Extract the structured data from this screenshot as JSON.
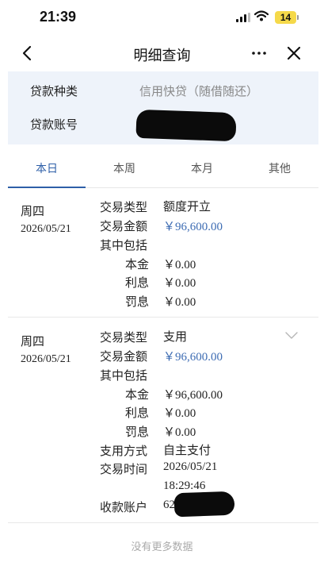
{
  "status_bar": {
    "time": "21:39",
    "battery": "14"
  },
  "nav": {
    "title": "明细查询",
    "back_icon": "chevron-left-icon",
    "more_icon": "ellipsis-icon",
    "close_icon": "close-icon"
  },
  "loan_info": {
    "type_label": "贷款种类",
    "type_value": "信用快贷（随借随还）",
    "account_label": "贷款账号",
    "account_value": ""
  },
  "tabs": [
    {
      "label": "本日",
      "active": true
    },
    {
      "label": "本周",
      "active": false
    },
    {
      "label": "本月",
      "active": false
    },
    {
      "label": "其他",
      "active": false
    }
  ],
  "records": [
    {
      "weekday": "周四",
      "date": "2026/05/21",
      "type_label": "交易类型",
      "type_value": "额度开立",
      "amount_label": "交易金额",
      "amount_value": "￥96,600.00",
      "includes_label": "其中包括",
      "principal_label": "本金",
      "principal_value": "￥0.00",
      "interest_label": "利息",
      "interest_value": "￥0.00",
      "penalty_label": "罚息",
      "penalty_value": "￥0.00"
    },
    {
      "weekday": "周四",
      "date": "2026/05/21",
      "type_label": "交易类型",
      "type_value": "支用",
      "amount_label": "交易金额",
      "amount_value": "￥96,600.00",
      "includes_label": "其中包括",
      "principal_label": "本金",
      "principal_value": "￥96,600.00",
      "interest_label": "利息",
      "interest_value": "￥0.00",
      "penalty_label": "罚息",
      "penalty_value": "￥0.00",
      "method_label": "支用方式",
      "method_value": "自主支付",
      "time_label": "交易时间",
      "time_date": "2026/05/21",
      "time_clock": "18:29:46",
      "payee_label": "收款账户",
      "payee_value": "62"
    }
  ],
  "footer": {
    "text": "没有更多数据"
  },
  "colors": {
    "accent": "#2e5fa8",
    "amount_blue": "#3d6cb3",
    "info_bg": "#eef3fa",
    "battery": "#f5d94a"
  }
}
